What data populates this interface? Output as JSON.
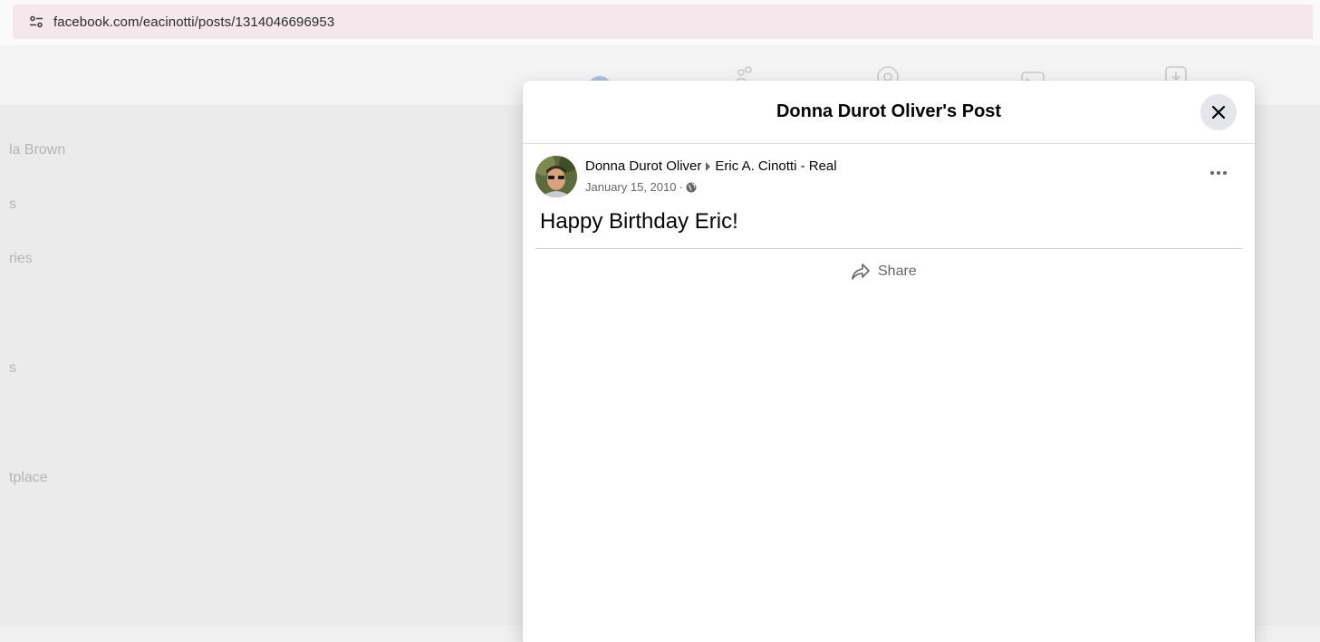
{
  "browser": {
    "url": "facebook.com/eacinotti/posts/1314046696953"
  },
  "nav": {
    "icons": [
      "home-icon",
      "friends-icon",
      "watch-icon",
      "gaming-icon",
      "notifications-icon"
    ]
  },
  "sidebar": {
    "items": [
      {
        "label": "la Brown"
      },
      {
        "label": "s"
      },
      {
        "label": "ries"
      },
      {
        "label": "s"
      },
      {
        "label": "tplace"
      }
    ]
  },
  "modal": {
    "title": "Donna Durot Oliver's Post",
    "post": {
      "author": "Donna Durot Oliver",
      "target": "Eric A. Cinotti - Real",
      "date": "January 15, 2010",
      "privacy_icon": "globe-icon",
      "text": "Happy Birthday Eric!",
      "share_label": "Share"
    }
  },
  "colors": {
    "accent": "#1877f2",
    "text_primary": "#050505",
    "text_secondary": "#65676b"
  }
}
